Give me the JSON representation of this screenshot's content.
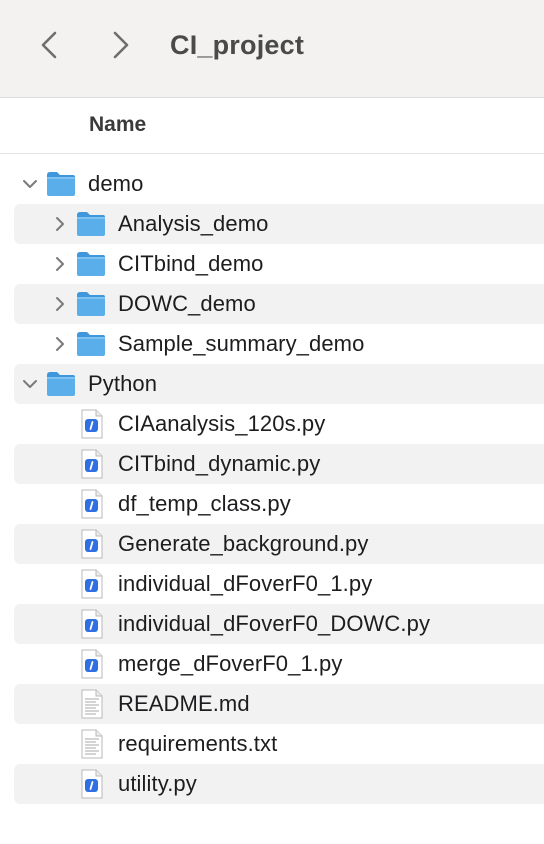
{
  "window": {
    "title": "CI_project",
    "back_icon": "chevron-left-icon",
    "forward_icon": "chevron-right-icon"
  },
  "header": {
    "name_column": "Name"
  },
  "colors": {
    "folder": "#5aaeea",
    "row_alt": "#f2f2f2",
    "python_badge": "#2f6fe0"
  },
  "items": [
    {
      "label": "demo",
      "kind": "folder",
      "level": 0,
      "expanded": true
    },
    {
      "label": "Analysis_demo",
      "kind": "folder",
      "level": 1,
      "expanded": false
    },
    {
      "label": "CITbind_demo",
      "kind": "folder",
      "level": 1,
      "expanded": false
    },
    {
      "label": "DOWC_demo",
      "kind": "folder",
      "level": 1,
      "expanded": false
    },
    {
      "label": "Sample_summary_demo",
      "kind": "folder",
      "level": 1,
      "expanded": false
    },
    {
      "label": "Python",
      "kind": "folder",
      "level": 0,
      "expanded": true
    },
    {
      "label": "CIAanalysis_120s.py",
      "kind": "python-file",
      "level": 1
    },
    {
      "label": "CITbind_dynamic.py",
      "kind": "python-file",
      "level": 1
    },
    {
      "label": "df_temp_class.py",
      "kind": "python-file",
      "level": 1
    },
    {
      "label": "Generate_background.py",
      "kind": "python-file",
      "level": 1
    },
    {
      "label": "individual_dFoverF0_1.py",
      "kind": "python-file",
      "level": 1
    },
    {
      "label": "individual_dFoverF0_DOWC.py",
      "kind": "python-file",
      "level": 1
    },
    {
      "label": "merge_dFoverF0_1.py",
      "kind": "python-file",
      "level": 1
    },
    {
      "label": "README.md",
      "kind": "text-file",
      "level": 1
    },
    {
      "label": "requirements.txt",
      "kind": "text-file",
      "level": 1
    },
    {
      "label": "utility.py",
      "kind": "python-file",
      "level": 1
    }
  ]
}
